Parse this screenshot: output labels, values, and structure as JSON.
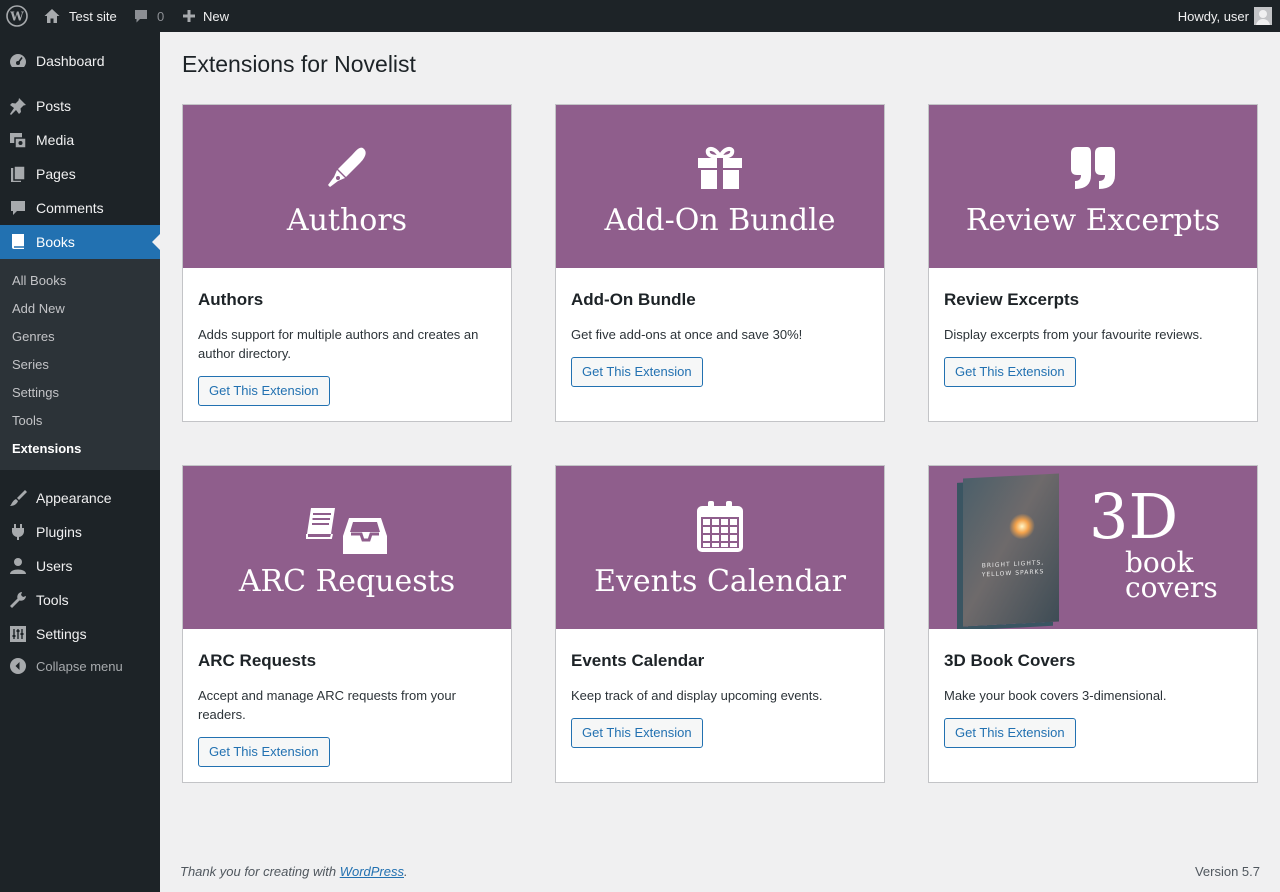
{
  "adminbar": {
    "site_name": "Test site",
    "comments_count": "0",
    "new_label": "New",
    "howdy": "Howdy, user"
  },
  "sidebar": {
    "items": [
      {
        "label": "Dashboard",
        "icon": "dashboard-icon"
      },
      {
        "label": "Posts",
        "icon": "pushpin-icon"
      },
      {
        "label": "Media",
        "icon": "media-icon"
      },
      {
        "label": "Pages",
        "icon": "pages-icon"
      },
      {
        "label": "Comments",
        "icon": "comment-icon"
      },
      {
        "label": "Books",
        "icon": "book-icon",
        "current": true
      },
      {
        "label": "Appearance",
        "icon": "paintbrush-icon"
      },
      {
        "label": "Plugins",
        "icon": "plugin-icon"
      },
      {
        "label": "Users",
        "icon": "user-icon"
      },
      {
        "label": "Tools",
        "icon": "wrench-icon"
      },
      {
        "label": "Settings",
        "icon": "settings-icon"
      }
    ],
    "submenu": [
      "All Books",
      "Add New",
      "Genres",
      "Series",
      "Settings",
      "Tools",
      "Extensions"
    ],
    "collapse_label": "Collapse menu"
  },
  "page": {
    "title": "Extensions for Novelist"
  },
  "cards": [
    {
      "banner_text": "Authors",
      "icon": "fountain-pen-icon",
      "title": "Authors",
      "description": "Adds support for multiple authors and creates an author directory.",
      "button": "Get This Extension"
    },
    {
      "banner_text": "Add-On Bundle",
      "icon": "gift-icon",
      "title": "Add-On Bundle",
      "description": "Get five add-ons at once and save 30%!",
      "button": "Get This Extension"
    },
    {
      "banner_text": "Review Excerpts",
      "icon": "quote-icon",
      "title": "Review Excerpts",
      "description": "Display excerpts from your favourite reviews.",
      "button": "Get This Extension"
    },
    {
      "banner_text": "ARC Requests",
      "icon": "book-inbox-icon",
      "title": "ARC Requests",
      "description": "Accept and manage ARC requests from your readers.",
      "button": "Get This Extension"
    },
    {
      "banner_text": "Events Calendar",
      "icon": "calendar-icon",
      "title": "Events Calendar",
      "description": "Keep track of and display upcoming events.",
      "button": "Get This Extension"
    },
    {
      "banner_big": "3D",
      "banner_small_1": "book",
      "banner_small_2": "covers",
      "book_cover_text": "BRIGHT LIGHTS, YELLOW SPARKS",
      "title": "3D Book Covers",
      "description": "Make your book covers 3-dimensional.",
      "button": "Get This Extension"
    }
  ],
  "footer": {
    "thanks_prefix": "Thank you for creating with ",
    "thanks_link": "WordPress",
    "thanks_suffix": ".",
    "version": "Version 5.7"
  },
  "colors": {
    "adminbar_bg": "#1d2327",
    "accent": "#2271b1",
    "banner": "#8f5e8c",
    "submenu_bg": "#2c3338"
  }
}
